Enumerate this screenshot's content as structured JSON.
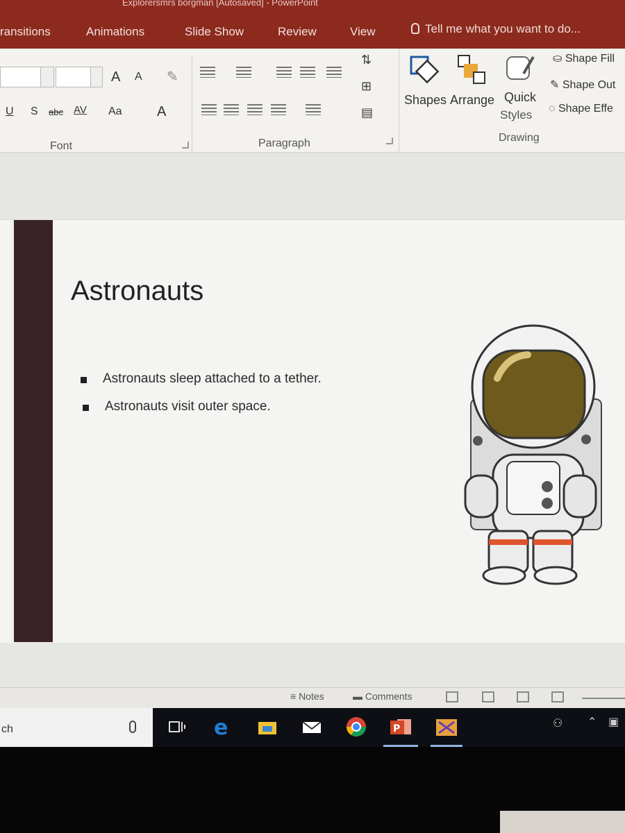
{
  "window": {
    "title": "Explorersmrs borgman [Autosaved] - PowerPoint"
  },
  "tabs": [
    {
      "label": "ransitions"
    },
    {
      "label": "Animations"
    },
    {
      "label": "Slide Show"
    },
    {
      "label": "Review"
    },
    {
      "label": "View"
    }
  ],
  "tell_me": {
    "placeholder": "Tell me what you want to do..."
  },
  "ribbon": {
    "font": {
      "group_label": "Font",
      "grow": "A",
      "shrink": "A",
      "underline": "U",
      "strike": "S",
      "abc": "abc",
      "spacing": "AV",
      "case": "Aa",
      "color": "A"
    },
    "paragraph": {
      "group_label": "Paragraph"
    },
    "drawing": {
      "group_label": "Drawing",
      "shapes": "Shapes",
      "arrange": "Arrange",
      "quick": "Quick",
      "styles": "Styles",
      "shape_fill": "Shape Fill",
      "shape_outline": "Shape Out",
      "shape_effects": "Shape Effe"
    }
  },
  "slide": {
    "title": "Astronauts",
    "bullets": [
      "Astronauts sleep attached to a tether.",
      "Astronauts visit outer space."
    ]
  },
  "statusbar": {
    "notes": "Notes",
    "comments": "Comments"
  },
  "taskbar": {
    "search_text": "ch",
    "apps": [
      "task-view",
      "edge",
      "file-explorer",
      "mail",
      "chrome",
      "powerpoint",
      "other-app"
    ]
  },
  "colors": {
    "ribbon_tab_bg": "#8c2a1e",
    "slide_stripe": "#3a2326",
    "taskbar_bg": "#0d0f14"
  }
}
